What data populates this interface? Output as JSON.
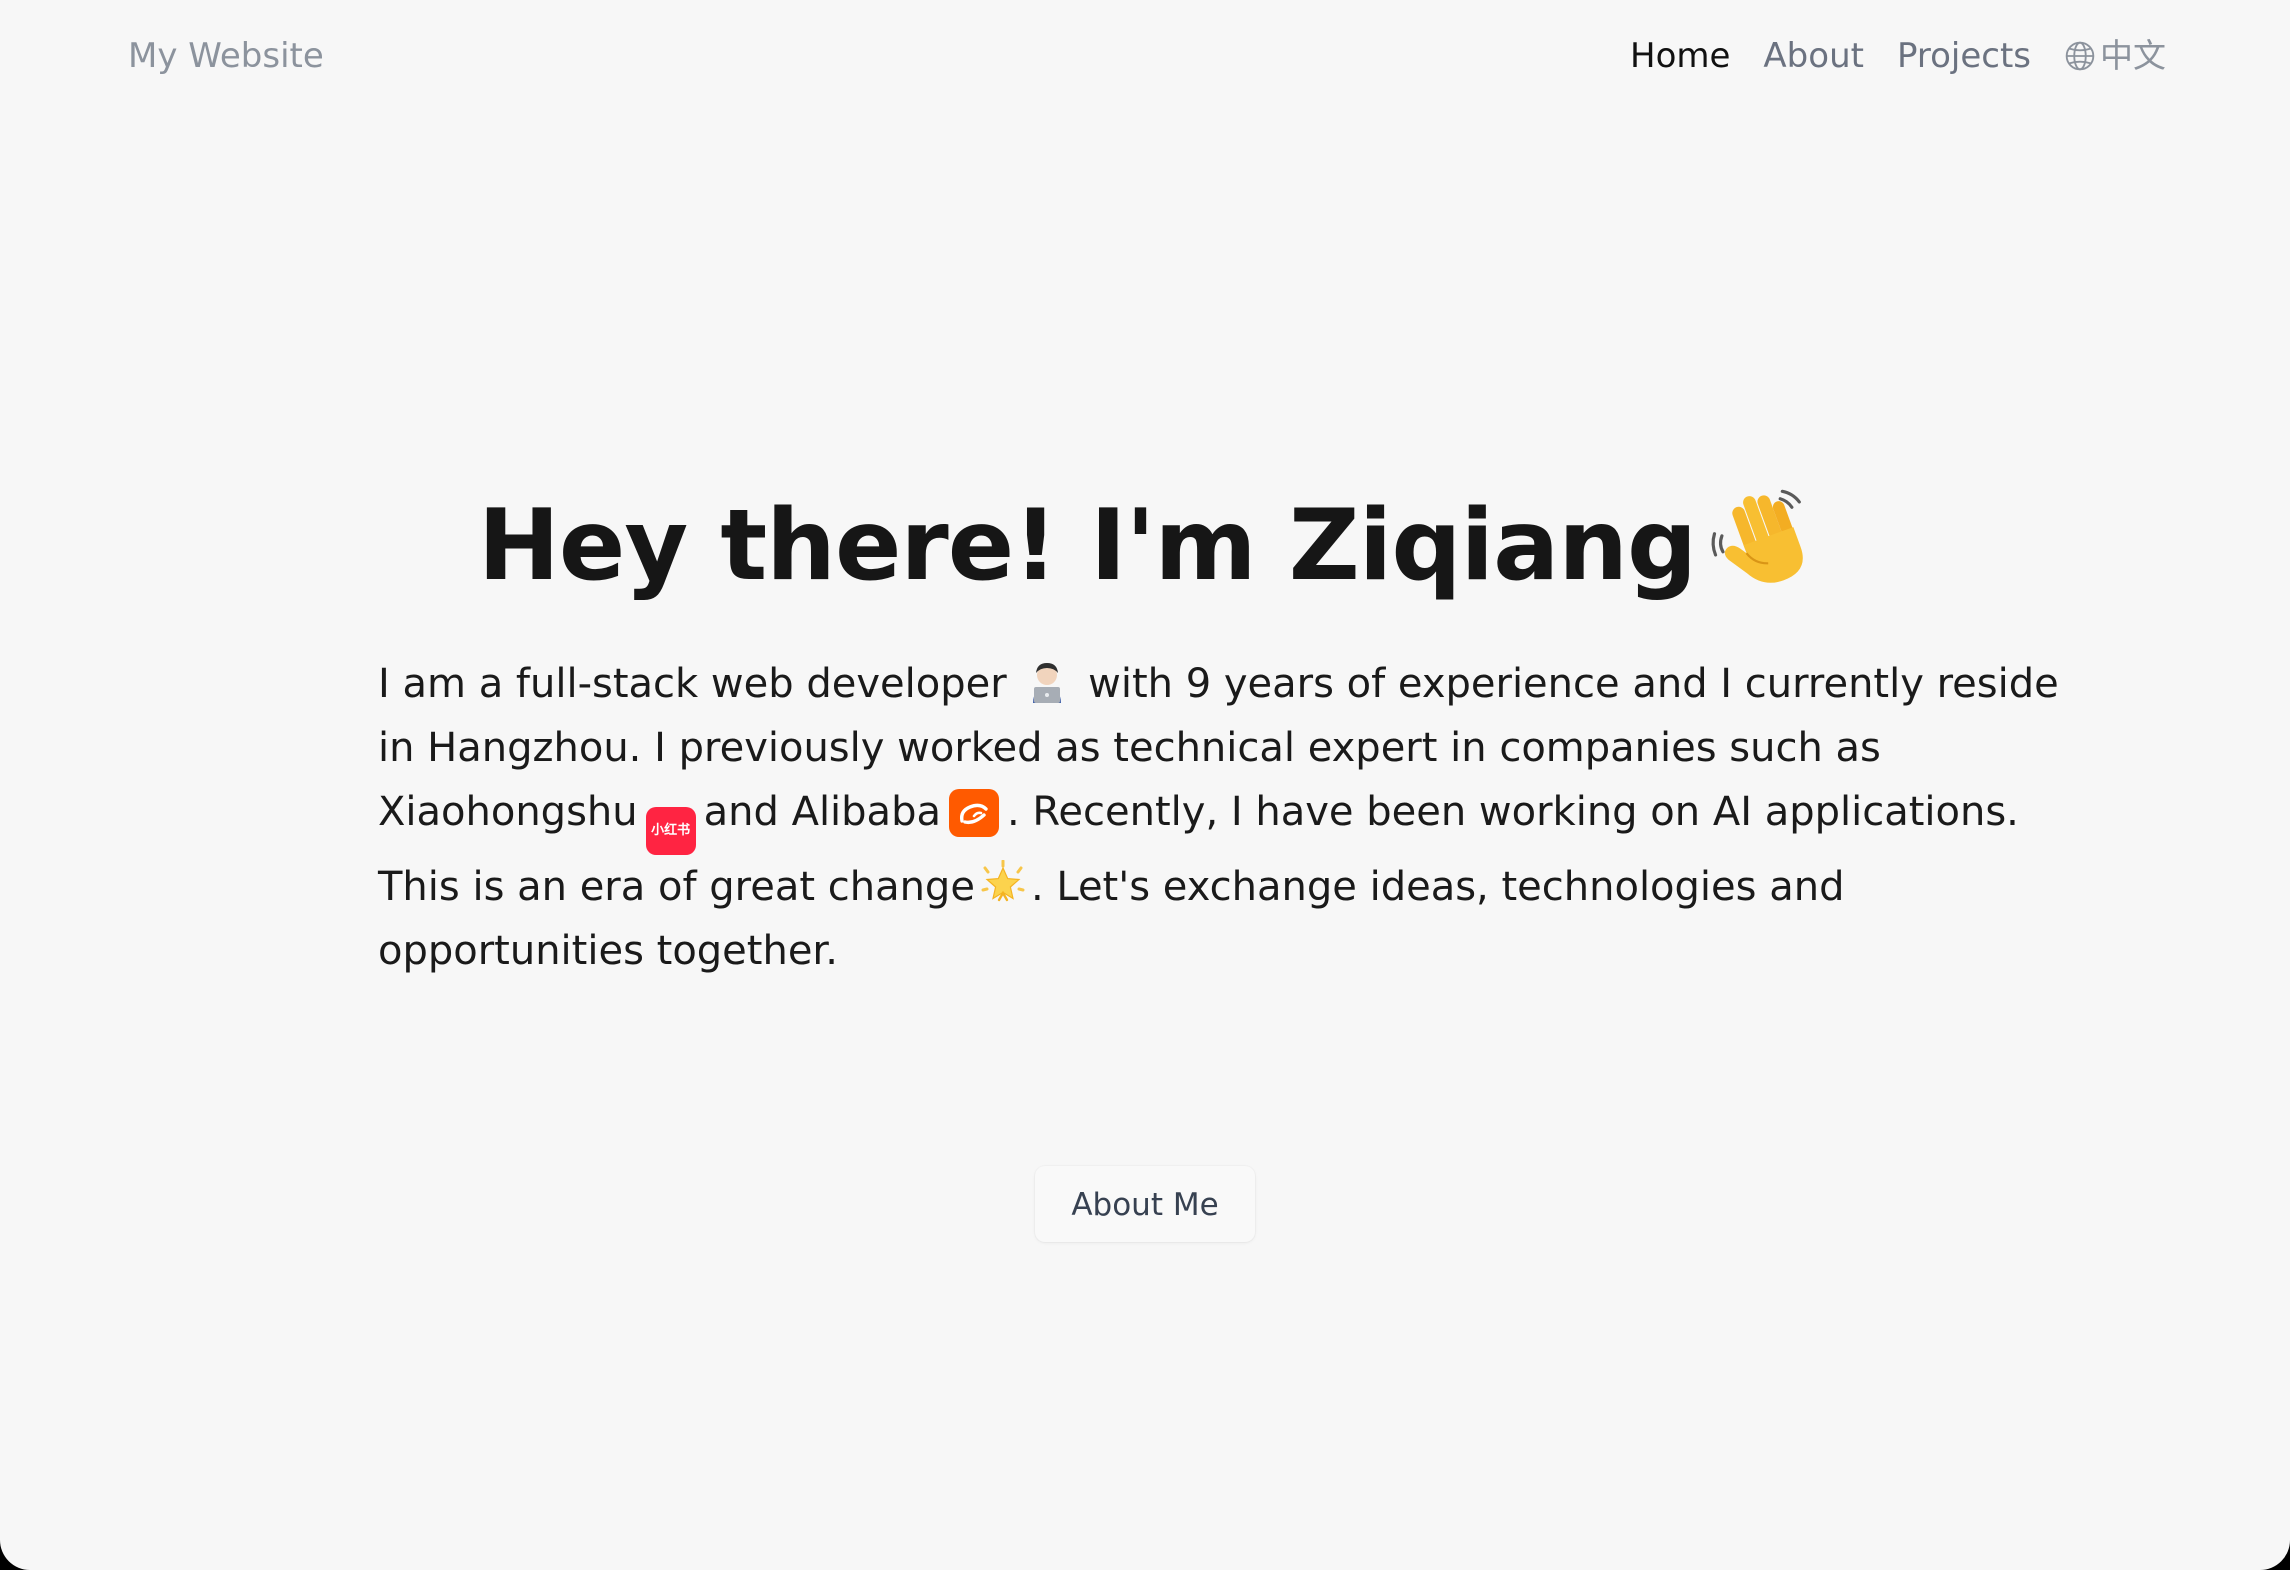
{
  "nav": {
    "brand": "My Website",
    "items": [
      {
        "label": "Home",
        "active": true
      },
      {
        "label": "About",
        "active": false
      },
      {
        "label": "Projects",
        "active": false
      }
    ],
    "language": {
      "icon": "globe-icon",
      "label": "中文"
    }
  },
  "hero": {
    "title": "Hey there! I'm Ziqiang",
    "title_emoji": "waving-hand-emoji"
  },
  "intro": {
    "line1_a": "I am a full-stack web developer",
    "line1_b": "with 9 years of experience and I currently reside",
    "line2": "in Hangzhou. I previously worked as technical expert in companies such as",
    "line3_a": "Xiaohongshu",
    "line3_b": "and Alibaba",
    "line3_c": ". Recently, I have been working on AI applications.",
    "line4_a": "This is an era of great change",
    "line4_b": ". Let's exchange ideas, technologies and",
    "line5": "opportunities together.",
    "xiaohongshu_logo_text": "小红书",
    "colors": {
      "xiaohongshu": "#ff2442",
      "alibaba": "#ff5a00"
    }
  },
  "cta": {
    "label": "About Me"
  }
}
